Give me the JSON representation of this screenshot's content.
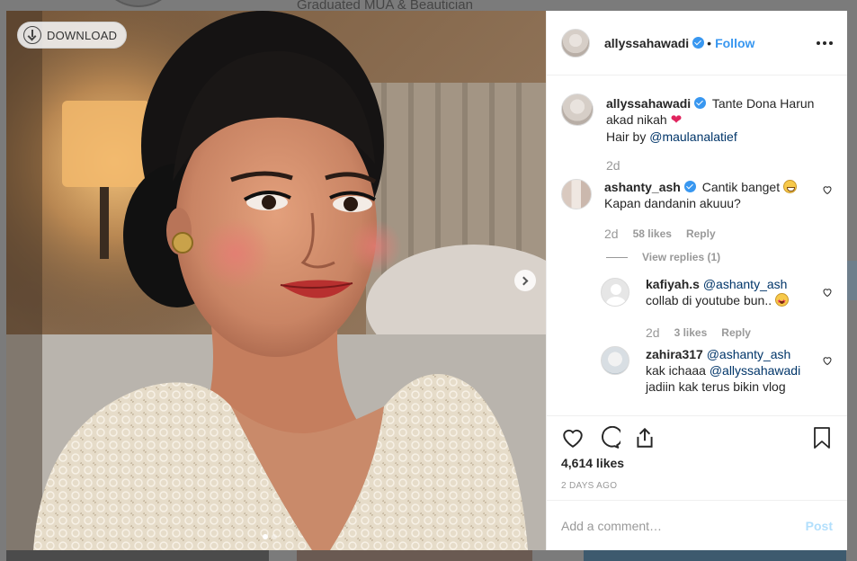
{
  "background": {
    "header_text": "Graduated MUA & Beautician"
  },
  "photo": {
    "download_label": "DOWNLOAD",
    "carousel_dots": 2,
    "carousel_active": 1
  },
  "post": {
    "username": "allyssahawadi",
    "verified": true,
    "separator": "•",
    "follow_label": "Follow",
    "caption_line1": "Tante Dona Harun",
    "caption_line2": "akad nikah",
    "caption_emoji": "❤",
    "caption_line3_prefix": "Hair by ",
    "caption_mention": "@maulanalatief",
    "caption_time": "2d",
    "likes": "4,614 likes",
    "date": "2 DAYS AGO"
  },
  "comments": [
    {
      "username": "ashanty_ash",
      "verified": true,
      "text_line1": "Cantik banget",
      "text_line2": "Kapan dandanin akuuu?",
      "time": "2d",
      "likes": "58 likes",
      "reply_label": "Reply",
      "view_replies": "View replies (1)",
      "replies": [
        {
          "username": "kafiyah.s",
          "mention": "@ashanty_ash",
          "text": "collab di youtube bun..",
          "time": "2d",
          "likes": "3 likes",
          "reply_label": "Reply"
        },
        {
          "username": "zahira317",
          "mention": "@ashanty_ash",
          "text_line2_prefix": "kak ichaaa ",
          "mention2": "@allyssahawadi",
          "text_line3": "jadiin kak terus bikin vlog"
        }
      ]
    }
  ],
  "add_comment": {
    "placeholder": "Add a comment…",
    "post_label": "Post"
  },
  "colors": {
    "accent": "#3897f0",
    "mention": "#003569",
    "muted": "#999999",
    "post_disabled": "#b2dffc"
  }
}
